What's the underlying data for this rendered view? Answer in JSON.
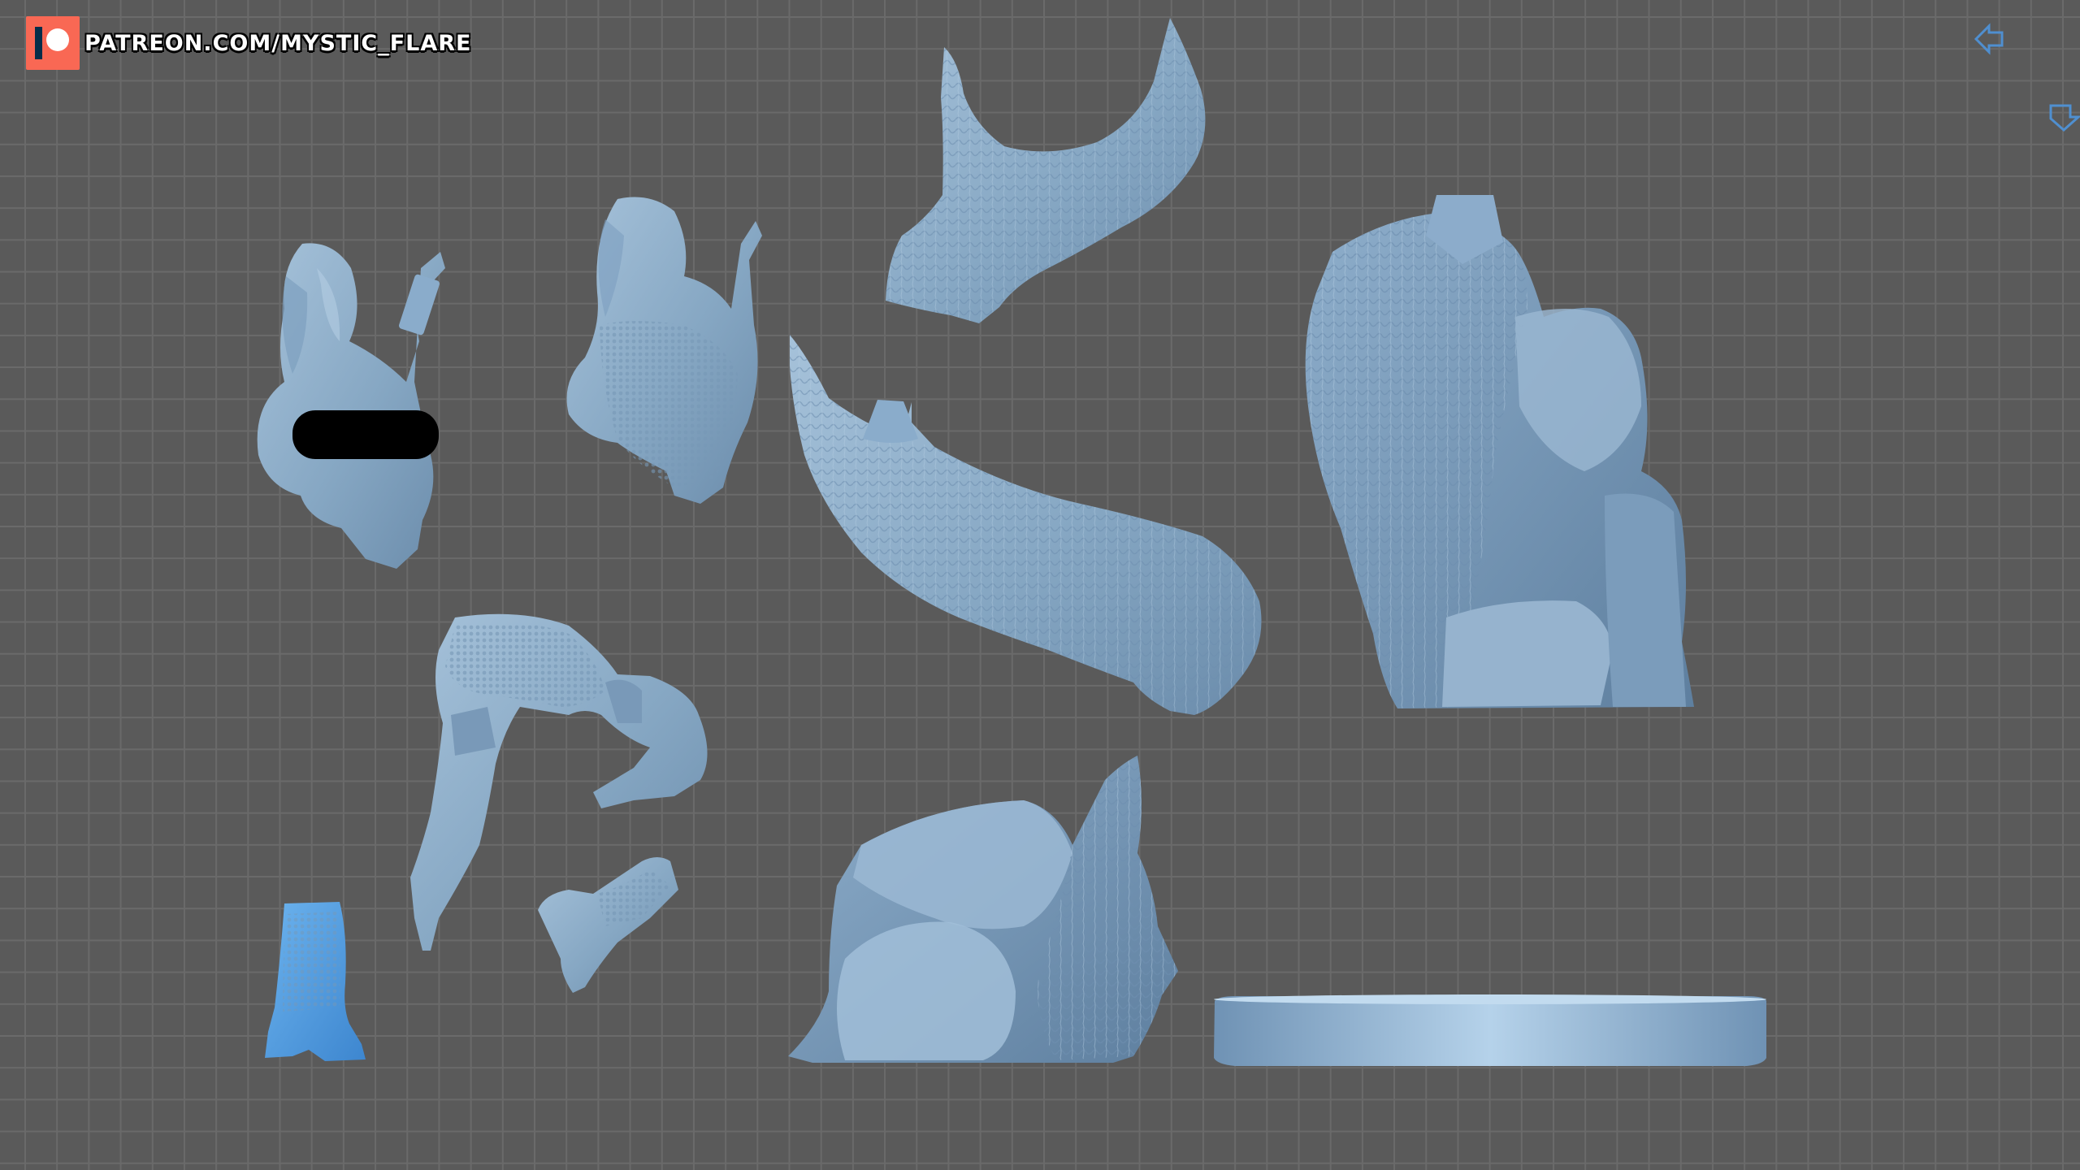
{
  "watermark": {
    "text": "PATREON.COM/MYSTIC_FLARE",
    "logo": "patreon-logo-icon",
    "logo_color": "#f96854"
  },
  "viewport": {
    "background": "#5a5a5a",
    "grid_color": "#6a6a6a",
    "model_color": "#8fb0cc",
    "highlight_color": "#5aa0e0"
  },
  "nav_icons": [
    "view-left-arrow-icon",
    "view-down-arrow-icon"
  ],
  "parts": [
    "upper-body-part",
    "clothed-upper-body-part",
    "legs-part",
    "boot-left-part",
    "boot-right-part",
    "tentacle-top-part",
    "tentacle-middle-part",
    "rock-tentacle-base-part",
    "large-rock-tentacle-part",
    "round-base-part"
  ],
  "censor_bar": "censor-bar"
}
